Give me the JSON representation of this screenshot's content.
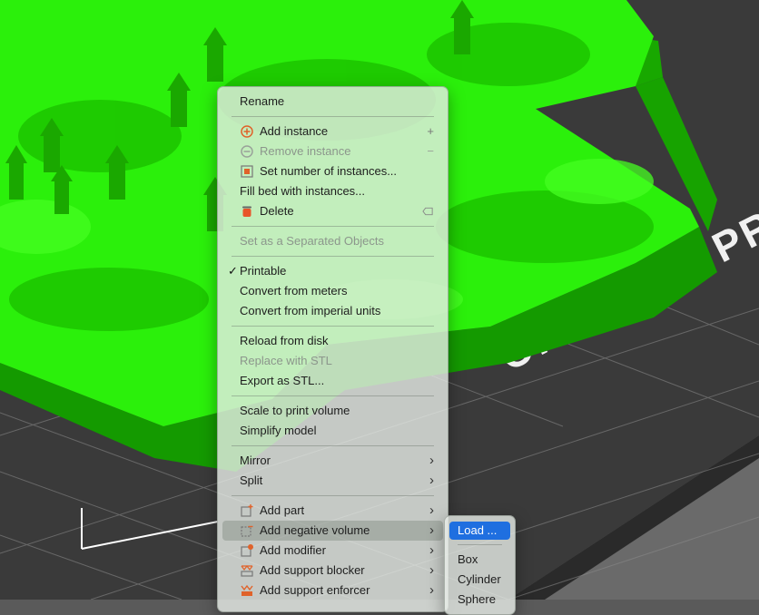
{
  "context_menu": {
    "rename": "Rename",
    "add_instance": "Add instance",
    "add_instance_shortcut": "+",
    "remove_instance": "Remove instance",
    "remove_instance_shortcut": "−",
    "set_number_instances": "Set number of instances...",
    "fill_bed": "Fill bed with instances...",
    "delete": "Delete",
    "set_separated": "Set as a Separated Objects",
    "printable": "Printable",
    "printable_checked": true,
    "convert_meters": "Convert from meters",
    "convert_imperial": "Convert from imperial units",
    "reload_disk": "Reload from disk",
    "replace_stl": "Replace with STL",
    "export_stl": "Export as STL...",
    "scale_print_volume": "Scale to print volume",
    "simplify_model": "Simplify model",
    "mirror": "Mirror",
    "split": "Split",
    "add_part": "Add part",
    "add_negative_volume": "Add negative volume",
    "add_modifier": "Add modifier",
    "add_support_blocker": "Add support blocker",
    "add_support_enforcer": "Add support enforcer"
  },
  "submenu": {
    "load": "Load ...",
    "box": "Box",
    "cylinder": "Cylinder",
    "sphere": "Sphere"
  },
  "scene": {
    "bed_text": "ORIGINAL PR",
    "model_color": "#22ee00",
    "bed_color": "#3a3a3a",
    "grid_color": "#8c8c8c"
  }
}
